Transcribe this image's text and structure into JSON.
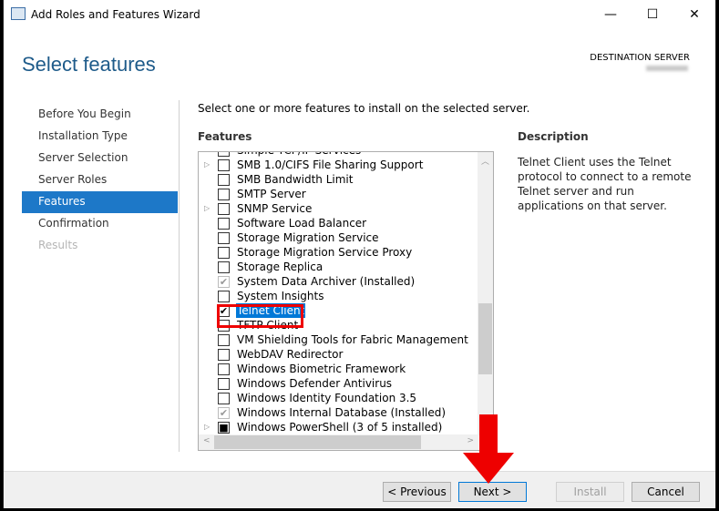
{
  "window": {
    "title": "Add Roles and Features Wizard",
    "minimize": "—",
    "maximize": "☐",
    "close": "✕"
  },
  "header": {
    "title": "Select features",
    "destination_label": "DESTINATION SERVER"
  },
  "nav": [
    {
      "label": "Before You Begin"
    },
    {
      "label": "Installation Type"
    },
    {
      "label": "Server Selection"
    },
    {
      "label": "Server Roles"
    },
    {
      "label": "Features",
      "selected": true
    },
    {
      "label": "Confirmation"
    },
    {
      "label": "Results",
      "disabled": true
    }
  ],
  "main": {
    "intro": "Select one or more features to install on the selected server.",
    "features_label": "Features",
    "features": [
      {
        "label": "Simple TCP/IP Services",
        "state": "unchecked"
      },
      {
        "label": "SMB 1.0/CIFS File Sharing Support",
        "state": "unchecked",
        "expandable": true
      },
      {
        "label": "SMB Bandwidth Limit",
        "state": "unchecked"
      },
      {
        "label": "SMTP Server",
        "state": "unchecked"
      },
      {
        "label": "SNMP Service",
        "state": "unchecked",
        "expandable": true
      },
      {
        "label": "Software Load Balancer",
        "state": "unchecked"
      },
      {
        "label": "Storage Migration Service",
        "state": "unchecked"
      },
      {
        "label": "Storage Migration Service Proxy",
        "state": "unchecked"
      },
      {
        "label": "Storage Replica",
        "state": "unchecked"
      },
      {
        "label": "System Data Archiver (Installed)",
        "state": "installed"
      },
      {
        "label": "System Insights",
        "state": "unchecked"
      },
      {
        "label": "Telnet Client",
        "state": "checked",
        "selected": true
      },
      {
        "label": "TFTP Client",
        "state": "unchecked"
      },
      {
        "label": "VM Shielding Tools for Fabric Management",
        "state": "unchecked"
      },
      {
        "label": "WebDAV Redirector",
        "state": "unchecked"
      },
      {
        "label": "Windows Biometric Framework",
        "state": "unchecked"
      },
      {
        "label": "Windows Defender Antivirus",
        "state": "unchecked"
      },
      {
        "label": "Windows Identity Foundation 3.5",
        "state": "unchecked"
      },
      {
        "label": "Windows Internal Database (Installed)",
        "state": "installed"
      },
      {
        "label": "Windows PowerShell (3 of 5 installed)",
        "state": "partial",
        "expandable": true
      }
    ],
    "description_label": "Description",
    "description": "Telnet Client uses the Telnet protocol to connect to a remote Telnet server and run applications on that server."
  },
  "footer": {
    "previous": "< Previous",
    "next": "Next >",
    "install": "Install",
    "cancel": "Cancel"
  },
  "colors": {
    "accent": "#0078d7",
    "annotation": "#e00000"
  }
}
